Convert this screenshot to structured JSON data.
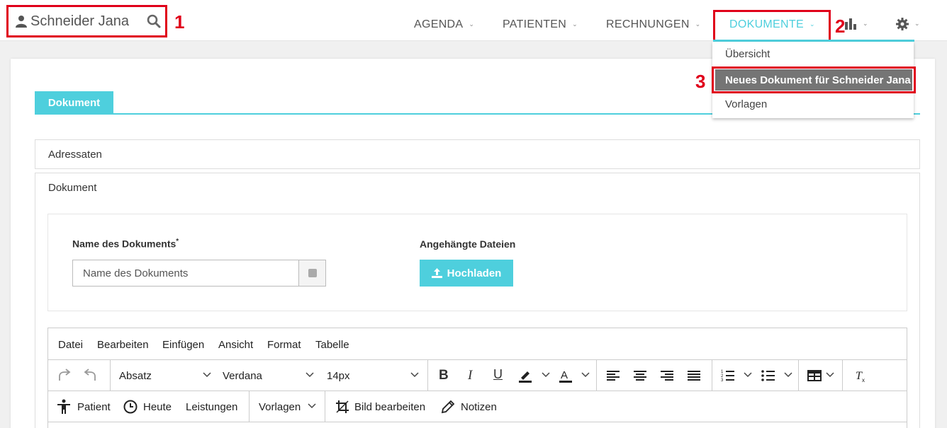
{
  "header": {
    "patient_name": "Schneider Jana",
    "annotations": {
      "a1": "1",
      "a2": "2",
      "a3": "3"
    },
    "nav": {
      "agenda": "AGENDA",
      "patienten": "PATIENTEN",
      "rechnungen": "RECHNUNGEN",
      "dokumente": "DOKUMENTE"
    },
    "icons": [
      "user-icon",
      "search-icon",
      "bar-chart-icon",
      "gear-icon"
    ]
  },
  "dropdown": {
    "items": [
      "Übersicht",
      "Neues Dokument für Schneider Jana",
      "Vorlagen"
    ]
  },
  "main": {
    "tab": "Dokument",
    "panel_adressaten": "Adressaten",
    "panel_dokument": "Dokument",
    "name_label": "Name des Dokuments",
    "name_required": "*",
    "name_placeholder": "Name des Dokuments",
    "attachments_label": "Angehängte Dateien",
    "upload_button": "Hochladen"
  },
  "editor": {
    "menu": [
      "Datei",
      "Bearbeiten",
      "Einfügen",
      "Ansicht",
      "Format",
      "Tabelle"
    ],
    "block_format": "Absatz",
    "font_family": "Verdana",
    "font_size": "14px",
    "toolbar2": {
      "patient": "Patient",
      "heute": "Heute",
      "leistungen": "Leistungen",
      "vorlagen": "Vorlagen",
      "bild": "Bild bearbeiten",
      "notizen": "Notizen"
    }
  },
  "colors": {
    "accent": "#4ecfdd",
    "highlight": "#e0001a",
    "active_item": "#757575"
  }
}
